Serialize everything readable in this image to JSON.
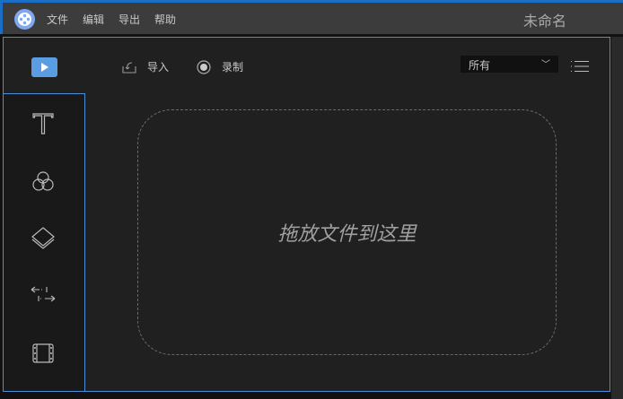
{
  "menu": [
    "文件",
    "编辑",
    "导出",
    "帮助"
  ],
  "title": "未命名",
  "toolbar": {
    "import_label": "导入",
    "record_label": "录制",
    "filter_value": "所有"
  },
  "dropzone": {
    "text": "拖放文件到这里"
  },
  "sidebar": [
    "media",
    "text",
    "filters",
    "overlays",
    "transitions",
    "elements"
  ],
  "colors": {
    "accent": "#5b9de3",
    "border": "#4a8fd8"
  }
}
